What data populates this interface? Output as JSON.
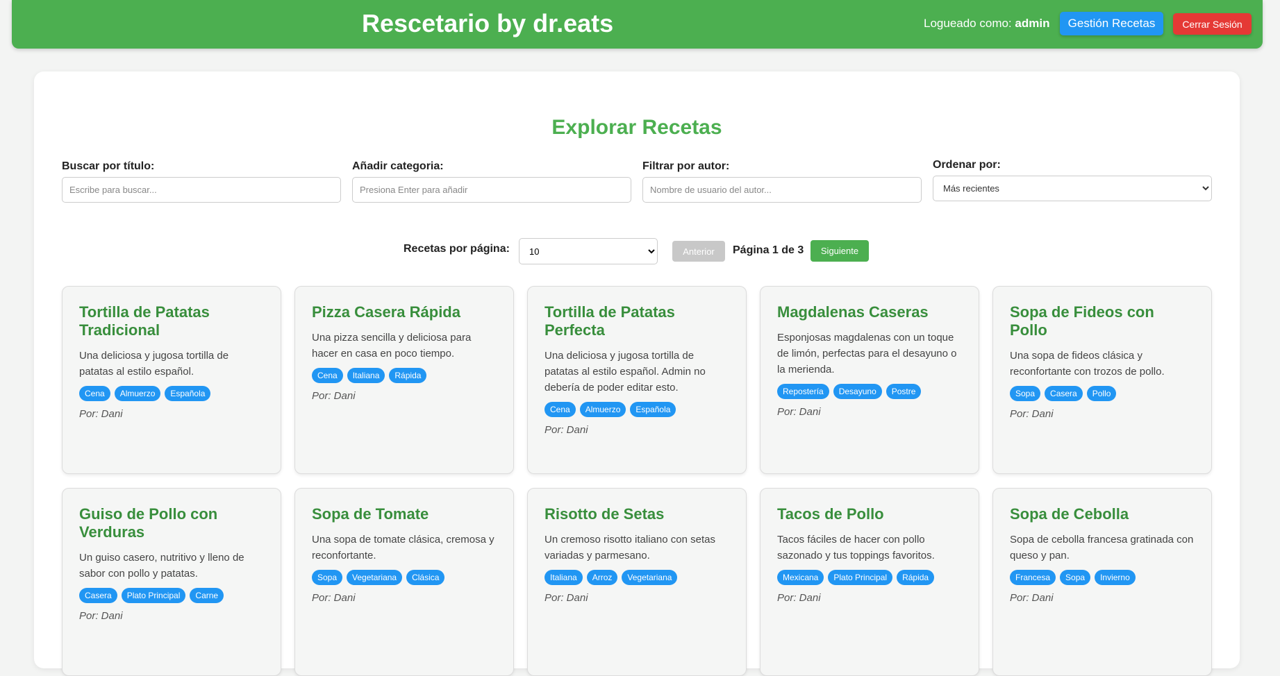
{
  "header": {
    "title": "Rescetario by dr.eats",
    "logged_as_label": "Logueado como:",
    "username": "admin",
    "manage_button": "Gestión Recetas",
    "logout_button": "Cerrar Sesión",
    "colors": {
      "bar": "#4caf50",
      "manage": "#2196f3",
      "logout": "#e53935"
    }
  },
  "main": {
    "title": "Explorar Recetas",
    "filters": {
      "search": {
        "label": "Buscar por título:",
        "placeholder": "Escribe para buscar...",
        "value": ""
      },
      "category": {
        "label": "Añadir categoria:",
        "placeholder": "Presiona Enter para añadir",
        "value": ""
      },
      "author": {
        "label": "Filtrar por autor:",
        "placeholder": "Nombre de usuario del autor...",
        "value": ""
      },
      "sort": {
        "label": "Ordenar por:",
        "value": "Más recientes"
      }
    },
    "pagination": {
      "per_page_label": "Recetas por página:",
      "per_page_value": "10",
      "prev_button": "Anterior",
      "page_text": "Página 1 de 3",
      "next_button": "Siguiente"
    },
    "author_prefix": "Por:",
    "recipes": [
      {
        "title": "Tortilla de Patatas Tradicional",
        "description": "Una deliciosa y jugosa tortilla de patatas al estilo español.",
        "tags": [
          "Cena",
          "Almuerzo",
          "Española"
        ],
        "author": "Por: Dani"
      },
      {
        "title": "Pizza Casera Rápida",
        "description": "Una pizza sencilla y deliciosa para hacer en casa en poco tiempo.",
        "tags": [
          "Cena",
          "Italiana",
          "Rápida"
        ],
        "author": "Por: Dani"
      },
      {
        "title": "Tortilla de Patatas Perfecta",
        "description": "Una deliciosa y jugosa tortilla de patatas al estilo español. Admin no debería de poder editar esto.",
        "tags": [
          "Cena",
          "Almuerzo",
          "Española"
        ],
        "author": "Por: Dani"
      },
      {
        "title": "Magdalenas Caseras",
        "description": "Esponjosas magdalenas con un toque de limón, perfectas para el desayuno o la merienda.",
        "tags": [
          "Repostería",
          "Desayuno",
          "Postre"
        ],
        "author": "Por: Dani"
      },
      {
        "title": "Sopa de Fideos con Pollo",
        "description": "Una sopa de fideos clásica y reconfortante con trozos de pollo.",
        "tags": [
          "Sopa",
          "Casera",
          "Pollo"
        ],
        "author": "Por: Dani"
      },
      {
        "title": "Guiso de Pollo con Verduras",
        "description": "Un guiso casero, nutritivo y lleno de sabor con pollo y patatas.",
        "tags": [
          "Casera",
          "Plato Principal",
          "Carne"
        ],
        "author": "Por: Dani"
      },
      {
        "title": "Sopa de Tomate",
        "description": "Una sopa de tomate clásica, cremosa y reconfortante.",
        "tags": [
          "Sopa",
          "Vegetariana",
          "Clásica"
        ],
        "author": "Por: Dani"
      },
      {
        "title": "Risotto de Setas",
        "description": "Un cremoso risotto italiano con setas variadas y parmesano.",
        "tags": [
          "Italiana",
          "Arroz",
          "Vegetariana"
        ],
        "author": "Por: Dani"
      },
      {
        "title": "Tacos de Pollo",
        "description": "Tacos fáciles de hacer con pollo sazonado y tus toppings favoritos.",
        "tags": [
          "Mexicana",
          "Plato Principal",
          "Rápida"
        ],
        "author": "Por: Dani"
      },
      {
        "title": "Sopa de Cebolla",
        "description": "Sopa de cebolla francesa gratinada con queso y pan.",
        "tags": [
          "Francesa",
          "Sopa",
          "Invierno"
        ],
        "author": "Por: Dani"
      }
    ]
  }
}
